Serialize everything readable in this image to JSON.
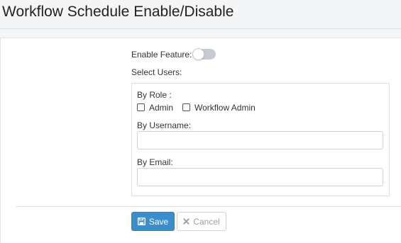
{
  "page": {
    "title": "Workflow Schedule Enable/Disable"
  },
  "form": {
    "enable_feature_label": "Enable Feature:",
    "enable_feature_on": false,
    "select_users_label": "Select Users:",
    "by_role_label": "By Role :",
    "roles": [
      {
        "label": "Admin",
        "checked": false
      },
      {
        "label": "Workflow Admin",
        "checked": false
      }
    ],
    "by_username_label": "By Username:",
    "username_value": "",
    "by_email_label": "By Email:",
    "email_value": ""
  },
  "actions": {
    "save_label": "Save",
    "cancel_label": "Cancel"
  },
  "colors": {
    "save_button": "#3c8dcc",
    "toggle_off": "#c7cbd1",
    "page_background": "#f4f5f7"
  },
  "icons": {
    "save": "floppy-disk-icon",
    "cancel": "x-icon"
  }
}
